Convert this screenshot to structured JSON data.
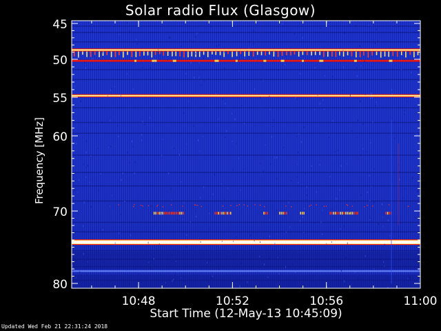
{
  "chart_data": {
    "type": "heatmap",
    "title": "Solar radio Flux (Glasgow)",
    "xlabel": "Start Time (12-May-13 10:45:09)",
    "ylabel": "Frequency [MHz]",
    "x_range": [
      "10:45:09",
      "11:00:00"
    ],
    "x_ticks": [
      {
        "label": "10:48",
        "minutes": 2.85
      },
      {
        "label": "10:52",
        "minutes": 6.85
      },
      {
        "label": "10:56",
        "minutes": 10.85
      },
      {
        "label": "11:00",
        "minutes": 14.85
      }
    ],
    "y_range": [
      45,
      80
    ],
    "y_ticks": [
      45,
      50,
      55,
      60,
      70,
      80
    ],
    "colormap": [
      "#0a0a5a",
      "#1a2ad0",
      "#ff2000",
      "#ffff80",
      "#ffffff"
    ],
    "emission_bands": [
      {
        "freq_mhz": 48.7,
        "intensity": "high",
        "continuous": true
      },
      {
        "freq_mhz": 50.2,
        "intensity": "medium",
        "continuous": true
      },
      {
        "freq_mhz": 49.4,
        "intensity": "high",
        "continuous": false
      },
      {
        "freq_mhz": 54.8,
        "intensity": "high",
        "continuous": true
      },
      {
        "freq_mhz": 70.3,
        "intensity": "medium",
        "continuous": false
      },
      {
        "freq_mhz": 74.3,
        "intensity": "very-high",
        "continuous": true
      },
      {
        "freq_mhz": 78.3,
        "intensity": "low",
        "continuous": true
      }
    ]
  },
  "footer": "Updated Wed Feb 21 22:31:24 2018"
}
